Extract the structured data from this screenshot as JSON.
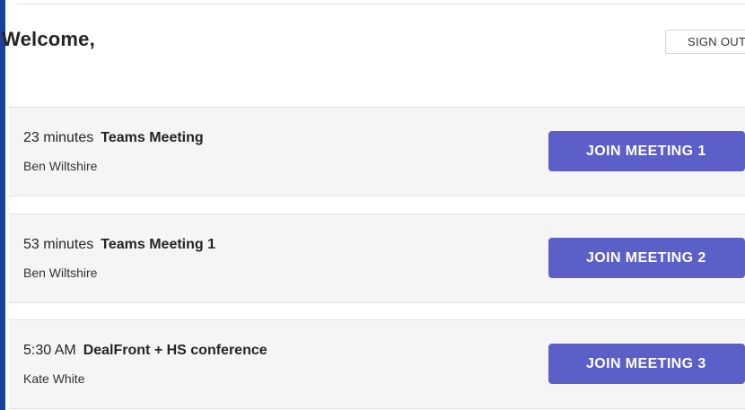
{
  "header": {
    "welcome_text": "Welcome,",
    "sign_out_label": "SIGN OUT"
  },
  "meetings": [
    {
      "time": "23 minutes",
      "title": "Teams Meeting",
      "organizer": "Ben Wiltshire",
      "join_label": "JOIN MEETING 1"
    },
    {
      "time": "53 minutes",
      "title": "Teams Meeting 1",
      "organizer": "Ben Wiltshire",
      "join_label": "JOIN MEETING 2"
    },
    {
      "time": "5:30 AM",
      "title": "DealFront + HS conference",
      "organizer": "Kate White",
      "join_label": "JOIN MEETING 3"
    }
  ],
  "colors": {
    "accent": "#5b5fc7",
    "frame": "#1c3f9e"
  }
}
